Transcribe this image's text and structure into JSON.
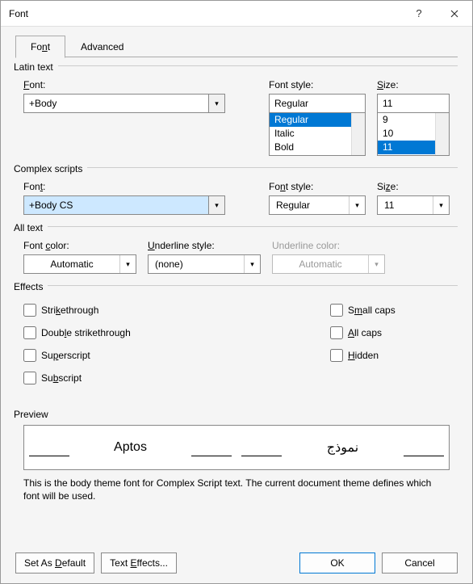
{
  "title": "Font",
  "tabs": {
    "font": "Font",
    "advanced": "Advanced"
  },
  "latin": {
    "group": "Latin text",
    "font_label": "Font:",
    "font_value": "+Body",
    "style_label": "Font style:",
    "style_value": "Regular",
    "style_options": [
      "Regular",
      "Italic",
      "Bold"
    ],
    "size_label": "Size:",
    "size_value": "11",
    "size_options": [
      "9",
      "10",
      "11"
    ]
  },
  "complex": {
    "group": "Complex scripts",
    "font_label": "Font:",
    "font_value": "+Body CS",
    "style_label": "Font style:",
    "style_value": "Regular",
    "size_label": "Size:",
    "size_value": "11"
  },
  "alltext": {
    "group": "All text",
    "font_color_label": "Font color:",
    "font_color_value": "Automatic",
    "underline_style_label": "Underline style:",
    "underline_style_value": "(none)",
    "underline_color_label": "Underline color:",
    "underline_color_value": "Automatic"
  },
  "effects": {
    "group": "Effects",
    "strikethrough": "Strikethrough",
    "double_strike": "Double strikethrough",
    "superscript": "Superscript",
    "subscript": "Subscript",
    "small_caps": "Small caps",
    "all_caps": "All caps",
    "hidden": "Hidden"
  },
  "preview": {
    "group": "Preview",
    "sample1": "Aptos",
    "sample2": "نموذج",
    "desc": "This is the body theme font for Complex Script text. The current document theme defines which font will be used."
  },
  "buttons": {
    "set_default": "Set As Default",
    "text_effects": "Text Effects...",
    "ok": "OK",
    "cancel": "Cancel"
  }
}
